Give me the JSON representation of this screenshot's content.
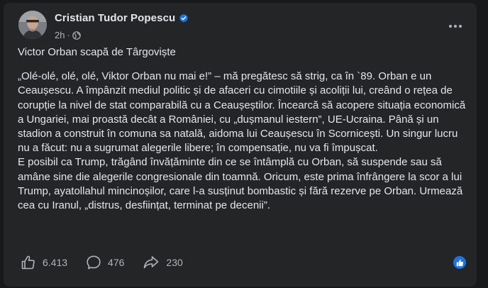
{
  "post": {
    "author": "Cristian Tudor Popescu",
    "time": "2h",
    "dot": "·",
    "title": "Victor Orban scapă de Târgoviște",
    "paragraph1": "„Olé-olé, olé, olé, Viktor Orban nu mai e!” – mă pregătesc să strig, ca în `89. Orban e un Ceaușescu. A împânzit mediul politic și de afaceri cu cimotiile și acoliții lui, creând o rețea de corupție la nivel de stat comparabilă cu a Ceaușeștilor. Încearcă să acopere situația economică a Ungariei, mai proastă decât a României, cu „dușmanul iestern”, UE-Ucraina. Până și un stadion a construit în comuna sa natală, aidoma lui Ceaușescu în Scornicești. Un singur lucru nu a făcut: nu a sugrumat alegerile libere; în compensație, nu va fi împușcat.",
    "paragraph2": "E posibil ca Trump, trăgând învățăminte din ce se întâmplă cu Orban, să suspende sau să amâne sine die alegerile congresionale din toamnă. Oricum, este prima înfrângere la scor a lui Trump, ayatollahul mincinoșilor, care l-a susținut bombastic și fără rezerve pe Orban. Urmează cea cu Iranul, „distrus, desființat, terminat pe decenii”."
  },
  "actions": {
    "likes": "6.413",
    "comments": "476",
    "shares": "230"
  },
  "icons": {
    "verified": "verified-badge-icon",
    "privacy": "globe-icon",
    "more": "more-horizontal-icon",
    "like": "thumbs-up-icon",
    "comment": "comment-bubble-icon",
    "share": "share-arrow-icon",
    "like_badge": "like-reaction-icon"
  },
  "colors": {
    "background": "#18191a",
    "card": "#242526",
    "text": "#e4e6eb",
    "secondary": "#b0b3b8",
    "accent": "#1b74e4"
  }
}
